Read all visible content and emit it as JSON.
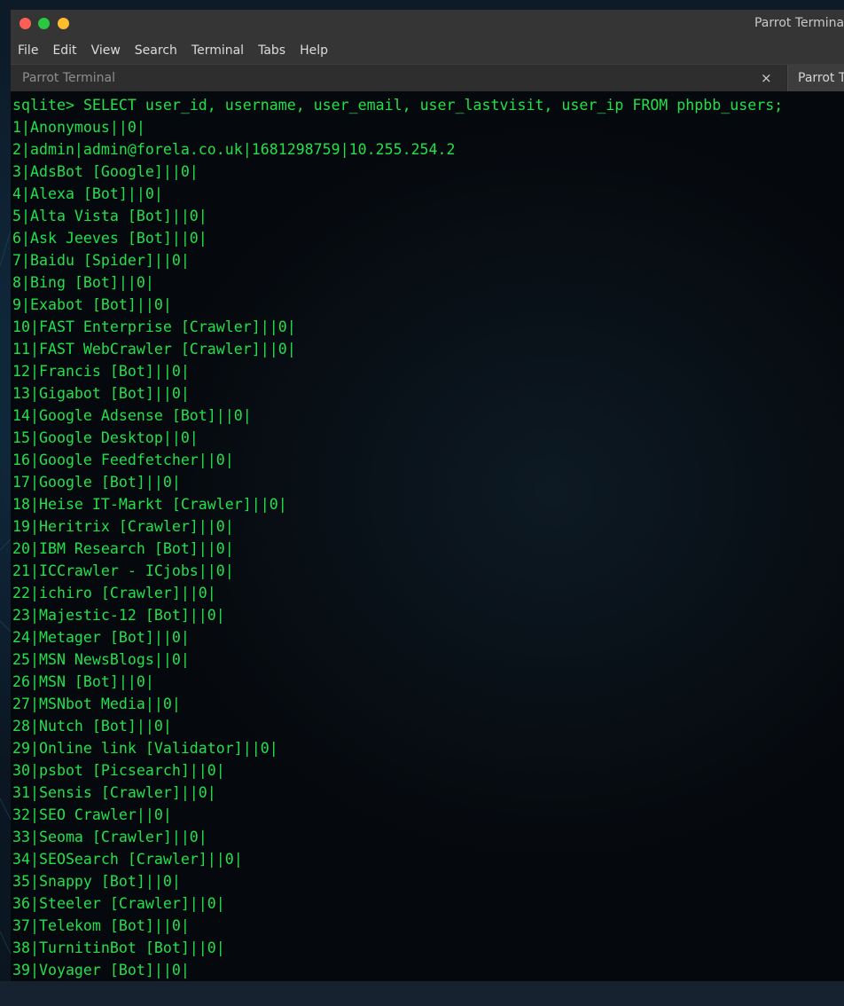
{
  "window": {
    "title": "Parrot Terminal",
    "controls": {
      "close_color": "#ff5f57",
      "minimize_color": "#28c840",
      "maximize_color": "#ffbd2e"
    }
  },
  "menubar": {
    "items": [
      "File",
      "Edit",
      "View",
      "Search",
      "Terminal",
      "Tabs",
      "Help"
    ]
  },
  "tabs": [
    {
      "label": "Parrot Terminal",
      "active": false,
      "close_glyph": "×"
    },
    {
      "label": "Parrot T",
      "active": true
    }
  ],
  "colors": {
    "terminal_text": "#22e04a",
    "terminal_background": "#05080c",
    "chrome": "#353535"
  },
  "terminal": {
    "prompt": "sqlite>",
    "command": "SELECT user_id, username, user_email, user_lastvisit, user_ip FROM phpbb_users;",
    "output": [
      "1|Anonymous||0|",
      "2|admin|admin@forela.co.uk|1681298759|10.255.254.2",
      "3|AdsBot [Google]||0|",
      "4|Alexa [Bot]||0|",
      "5|Alta Vista [Bot]||0|",
      "6|Ask Jeeves [Bot]||0|",
      "7|Baidu [Spider]||0|",
      "8|Bing [Bot]||0|",
      "9|Exabot [Bot]||0|",
      "10|FAST Enterprise [Crawler]||0|",
      "11|FAST WebCrawler [Crawler]||0|",
      "12|Francis [Bot]||0|",
      "13|Gigabot [Bot]||0|",
      "14|Google Adsense [Bot]||0|",
      "15|Google Desktop||0|",
      "16|Google Feedfetcher||0|",
      "17|Google [Bot]||0|",
      "18|Heise IT-Markt [Crawler]||0|",
      "19|Heritrix [Crawler]||0|",
      "20|IBM Research [Bot]||0|",
      "21|ICCrawler - ICjobs||0|",
      "22|ichiro [Crawler]||0|",
      "23|Majestic-12 [Bot]||0|",
      "24|Metager [Bot]||0|",
      "25|MSN NewsBlogs||0|",
      "26|MSN [Bot]||0|",
      "27|MSNbot Media||0|",
      "28|Nutch [Bot]||0|",
      "29|Online link [Validator]||0|",
      "30|psbot [Picsearch]||0|",
      "31|Sensis [Crawler]||0|",
      "32|SEO Crawler||0|",
      "33|Seoma [Crawler]||0|",
      "34|SEOSearch [Crawler]||0|",
      "35|Snappy [Bot]||0|",
      "36|Steeler [Crawler]||0|",
      "37|Telekom [Bot]||0|",
      "38|TurnitinBot [Bot]||0|",
      "39|Voyager [Bot]||0|"
    ]
  }
}
